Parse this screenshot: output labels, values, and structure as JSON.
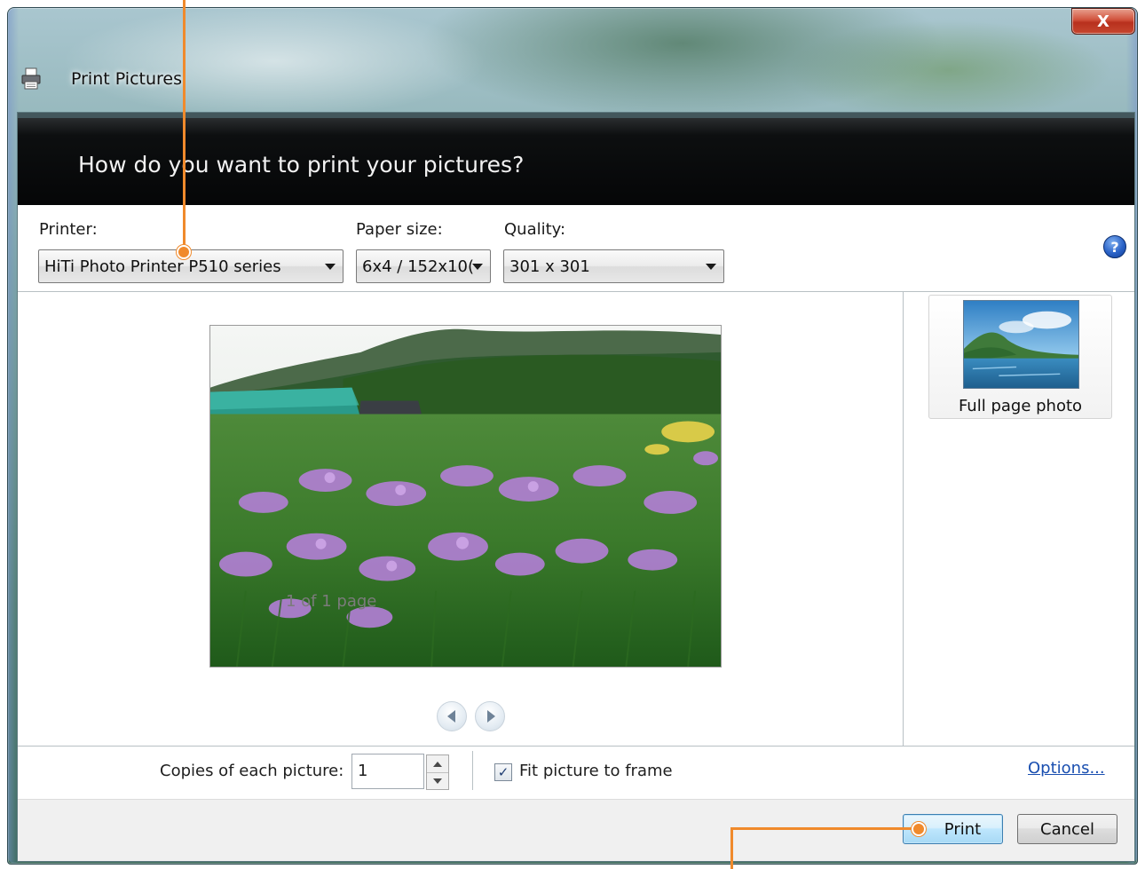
{
  "window": {
    "title": "Print Pictures",
    "close_glyph": "X",
    "icon": "printer-icon"
  },
  "banner": {
    "heading": "How do you want to print your pictures?"
  },
  "settings": {
    "printer_label": "Printer:",
    "printer_value": "HiTi Photo Printer P510 series",
    "paper_size_label": "Paper size:",
    "paper_size_value": "6x4 / 152x10(",
    "quality_label": "Quality:",
    "quality_value": "301 x 301",
    "help_glyph": "?"
  },
  "preview": {
    "page_indicator": "1 of 1 page",
    "prev_icon": "previous-arrow-icon",
    "next_icon": "next-arrow-icon"
  },
  "layouts": [
    {
      "label": "Full page photo",
      "selected": true
    }
  ],
  "options": {
    "copies_label": "Copies of each picture:",
    "copies_value": "1",
    "fit_label": "Fit picture to frame",
    "fit_checked": true,
    "check_glyph": "✓",
    "options_link": "Options..."
  },
  "buttons": {
    "print": "Print",
    "cancel": "Cancel"
  },
  "colors": {
    "callout": "#f08a2c",
    "banner_bg": "#0d0f10",
    "link": "#1a4fb0"
  }
}
